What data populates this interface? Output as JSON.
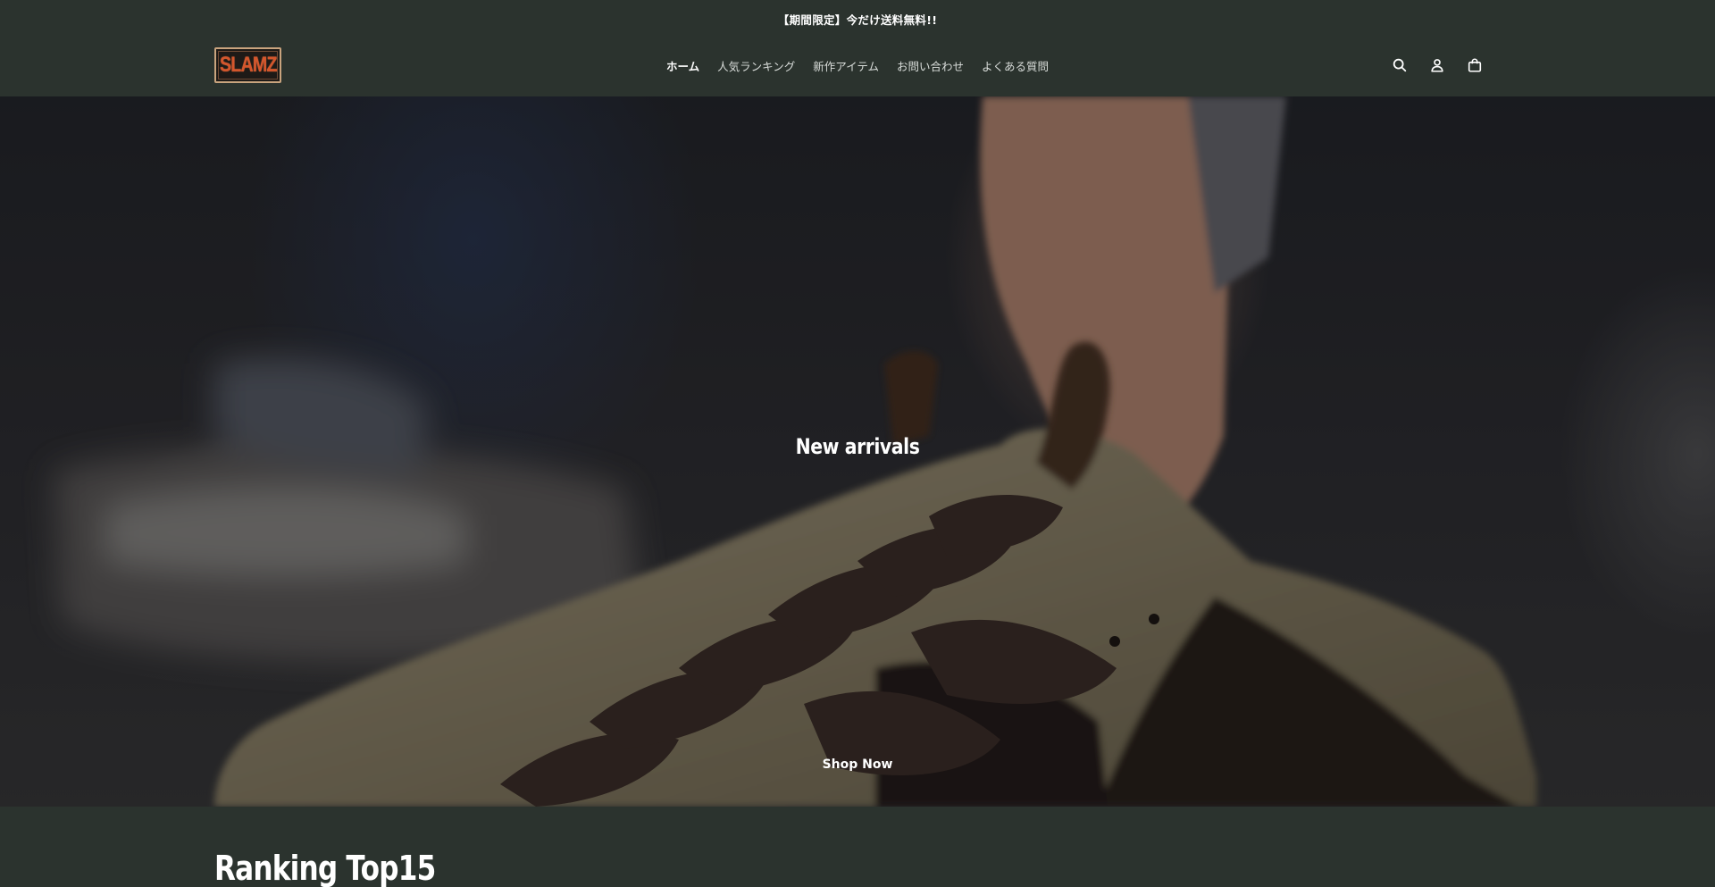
{
  "announcement": {
    "text": "【期間限定】今だけ送料無料!!"
  },
  "header": {
    "logo_text": "SLAMZ",
    "nav": [
      {
        "label": "ホーム",
        "active": true
      },
      {
        "label": "人気ランキング",
        "active": false
      },
      {
        "label": "新作アイテム",
        "active": false
      },
      {
        "label": "お問い合わせ",
        "active": false
      },
      {
        "label": "よくある質問",
        "active": false
      }
    ],
    "icons": [
      "search-icon",
      "account-icon",
      "cart-icon"
    ]
  },
  "hero": {
    "title": "New arrivals",
    "cta_label": "Shop Now"
  },
  "ranking": {
    "title": "Ranking Top15"
  },
  "colors": {
    "background": "#2b332e",
    "logo_accent": "#d4562c",
    "logo_border": "#c9a47e",
    "text": "#ffffff"
  }
}
